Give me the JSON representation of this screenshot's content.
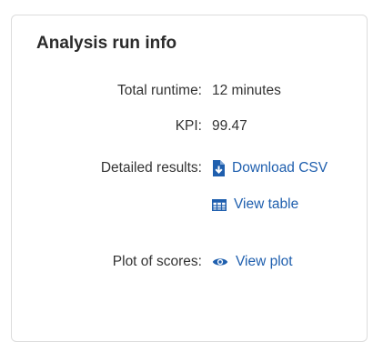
{
  "card": {
    "title": "Analysis run info"
  },
  "rows": {
    "runtime": {
      "label": "Total runtime:",
      "value": "12 minutes"
    },
    "kpi": {
      "label": "KPI:",
      "value": "99.47"
    },
    "results": {
      "label": "Detailed results:",
      "download_csv": "Download CSV",
      "view_table": "View table"
    },
    "plot": {
      "label": "Plot of scores:",
      "view_plot": "View plot"
    }
  },
  "colors": {
    "link": "#1f5fae",
    "text": "#333333",
    "border": "#dcdcdc"
  },
  "icons": {
    "download_csv": "file-download-icon",
    "view_table": "table-icon",
    "view_plot": "eye-icon"
  }
}
